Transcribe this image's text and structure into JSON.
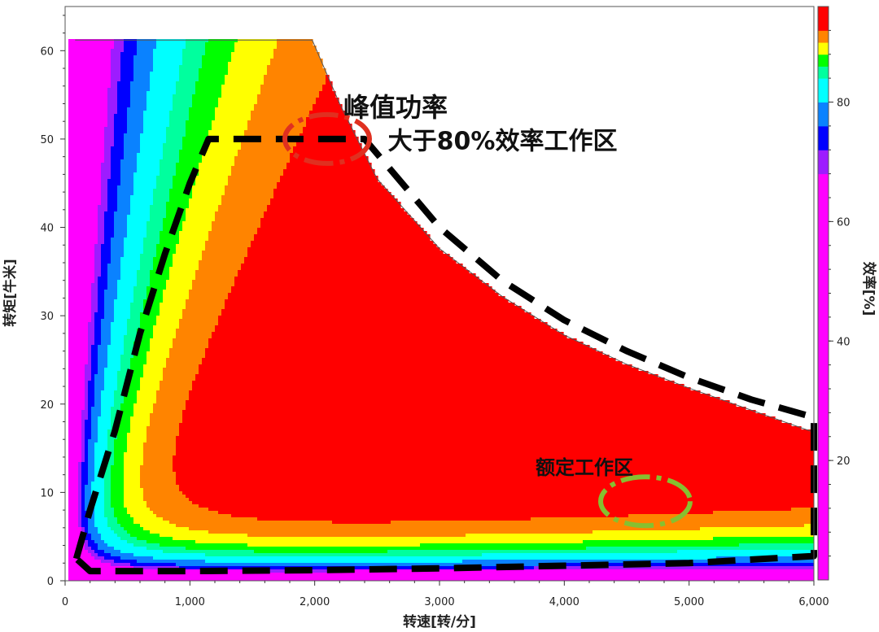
{
  "chart_data": {
    "type": "contour",
    "xlabel": "转速[转/分]",
    "ylabel": "转矩[牛米]",
    "colorbar_label": "效率[%]",
    "xlim": [
      0,
      6000
    ],
    "ylim": [
      0,
      65
    ],
    "x_ticks": [
      0,
      1000,
      2000,
      3000,
      4000,
      5000,
      6000
    ],
    "x_tick_labels": [
      "0",
      "1,000",
      "2,000",
      "3,000",
      "4,000",
      "5,000",
      "6,000"
    ],
    "y_ticks": [
      0,
      10,
      20,
      30,
      40,
      50,
      60
    ],
    "y_tick_labels": [
      "0",
      "10",
      "20",
      "30",
      "40",
      "50",
      "60"
    ],
    "colorbar_range": [
      0,
      96
    ],
    "colorbar_ticks": [
      20,
      40,
      60,
      80
    ],
    "colorbar_tick_labels": [
      "20",
      "40",
      "60",
      "80"
    ],
    "levels": [
      {
        "min": 0,
        "max": 68,
        "color": "#ff00ff"
      },
      {
        "min": 68,
        "max": 72,
        "color": "#9d1cff"
      },
      {
        "min": 72,
        "max": 76,
        "color": "#0000ff"
      },
      {
        "min": 76,
        "max": 80,
        "color": "#0a82ff"
      },
      {
        "min": 80,
        "max": 84,
        "color": "#00ffff"
      },
      {
        "min": 84,
        "max": 86,
        "color": "#00ff9e"
      },
      {
        "min": 86,
        "max": 88,
        "color": "#00ff00"
      },
      {
        "min": 88,
        "max": 90,
        "color": "#ffff00"
      },
      {
        "min": 90,
        "max": 92,
        "color": "#ff8400"
      },
      {
        "min": 92,
        "max": 94,
        "color": "#ff0000"
      },
      {
        "min": 94,
        "max": 96,
        "color": "#ff0000"
      }
    ],
    "torque_envelope": [
      [
        80,
        61.2
      ],
      [
        1980,
        61.2
      ],
      [
        2200,
        54
      ],
      [
        2500,
        45.5
      ],
      [
        3000,
        37.6
      ],
      [
        3500,
        32.2
      ],
      [
        4000,
        27.8
      ],
      [
        4500,
        24.5
      ],
      [
        5000,
        21.8
      ],
      [
        5500,
        19.3
      ],
      [
        6000,
        16.8
      ]
    ],
    "efficiency_80_boundary": [
      [
        90,
        2.5
      ],
      [
        200,
        8
      ],
      [
        400,
        17
      ],
      [
        600,
        28
      ],
      [
        800,
        37
      ],
      [
        1000,
        45
      ],
      [
        1150,
        50
      ],
      [
        2400,
        50
      ],
      [
        2700,
        45
      ],
      [
        3000,
        40
      ],
      [
        3500,
        34
      ],
      [
        4000,
        29.5
      ],
      [
        4500,
        26
      ],
      [
        5000,
        23
      ],
      [
        5500,
        20.5
      ],
      [
        6000,
        18.5
      ],
      [
        6000,
        2.8
      ],
      [
        5000,
        2.0
      ],
      [
        4000,
        1.7
      ],
      [
        3000,
        1.4
      ],
      [
        2000,
        1.2
      ],
      [
        1000,
        1.1
      ],
      [
        200,
        1.1
      ],
      [
        90,
        2.5
      ]
    ],
    "annotations": [
      {
        "text": "峰值功率",
        "x": 2100,
        "y": 50
      },
      {
        "text": "大于80%效率工作区",
        "x": 3500,
        "y": 38
      },
      {
        "text": "额定工作区",
        "x": 4650,
        "y": 9
      }
    ]
  }
}
